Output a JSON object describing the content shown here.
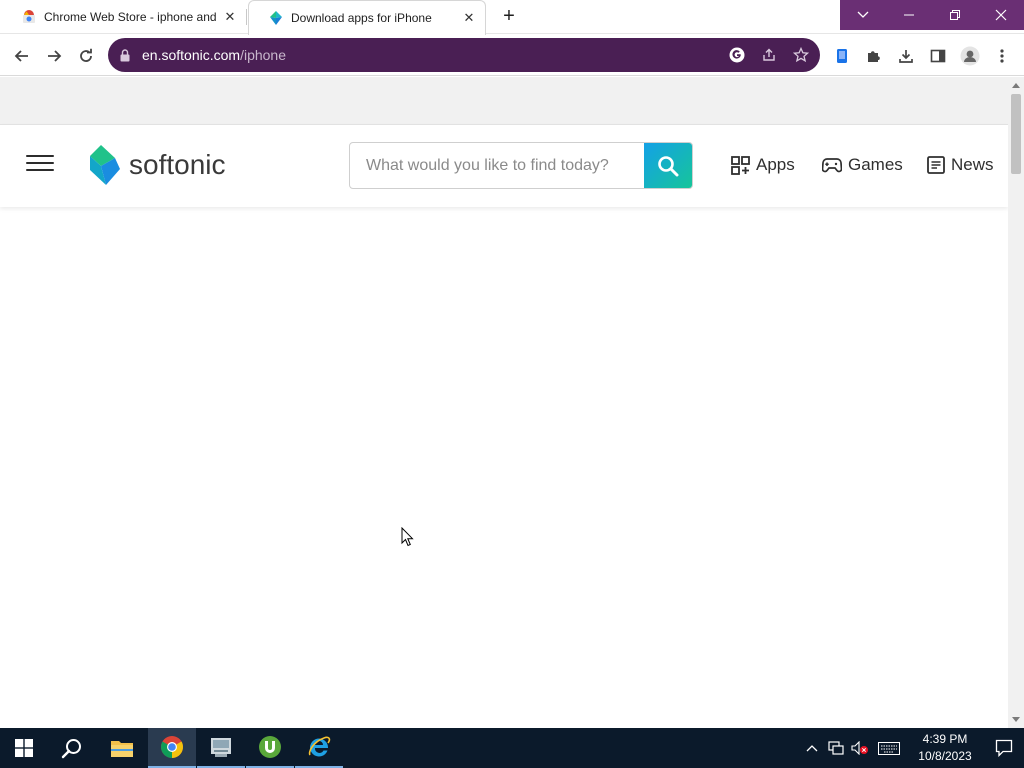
{
  "browser": {
    "tabs": [
      {
        "title": "Chrome Web Store - iphone and",
        "favicon": "chrome-web-store-icon",
        "active": false
      },
      {
        "title": "Download apps for iPhone",
        "favicon": "softonic-icon",
        "active": true
      }
    ],
    "new_tab_label": "+",
    "url_host": "en.softonic.com",
    "url_path": "/iphone",
    "accent_color": "#6a2f74",
    "omnibox_color": "#4a1f54"
  },
  "site": {
    "brand": "softonic",
    "search_placeholder": "What would you like to find today?",
    "nav": [
      {
        "label": "Apps",
        "icon": "apps-grid-icon"
      },
      {
        "label": "Games",
        "icon": "gamepad-icon"
      },
      {
        "label": "News",
        "icon": "news-icon"
      }
    ],
    "search_button_color": "#14a1e6"
  },
  "taskbar": {
    "apps": [
      "start-icon",
      "search-icon",
      "file-explorer-icon",
      "chrome-icon",
      "scanner-app-icon",
      "utorrent-icon",
      "internet-explorer-icon"
    ],
    "time": "4:39 PM",
    "date": "10/8/2023"
  }
}
